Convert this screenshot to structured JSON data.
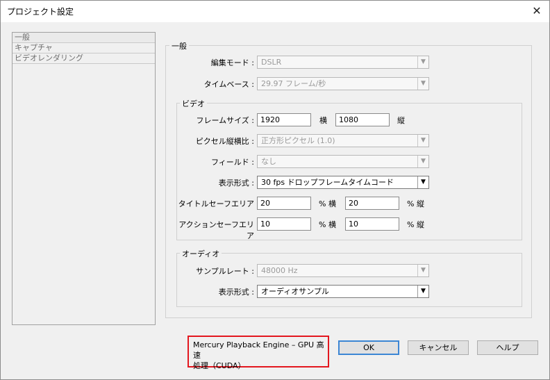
{
  "window": {
    "title": "プロジェクト設定",
    "close": "✕"
  },
  "sidebar": {
    "items": [
      {
        "label": "一般",
        "selected": true
      },
      {
        "label": "キャプチャ",
        "selected": false
      },
      {
        "label": "ビデオレンダリング",
        "selected": false
      }
    ]
  },
  "general": {
    "heading": "一般",
    "edit_mode": {
      "label": "編集モード :",
      "value": "DSLR"
    },
    "timebase": {
      "label": "タイムベース :",
      "value": "29.97 フレーム/秒"
    },
    "video": {
      "heading": "ビデオ",
      "frame_size": {
        "label": "フレームサイズ :",
        "width": "1920",
        "width_unit": "横",
        "height": "1080",
        "height_unit": "縦"
      },
      "pixel_aspect": {
        "label": "ピクセル縦横比 :",
        "value": "正方形ピクセル (1.0)"
      },
      "fields": {
        "label": "フィールド :",
        "value": "なし"
      },
      "display_format": {
        "label": "表示形式 :",
        "value": "30 fps ドロップフレームタイムコード"
      },
      "title_safe": {
        "label": "タイトルセーフエリア",
        "h": "20",
        "h_unit": "% 横",
        "v": "20",
        "v_unit": "% 縦"
      },
      "action_safe": {
        "label": "アクションセーフエリア",
        "h": "10",
        "h_unit": "% 横",
        "v": "10",
        "v_unit": "% 縦"
      }
    },
    "audio": {
      "heading": "オーディオ",
      "sample_rate": {
        "label": "サンプルレート :",
        "value": "48000 Hz"
      },
      "display_format": {
        "label": "表示形式 :",
        "value": "オーディオサンプル"
      }
    }
  },
  "playback": {
    "line1": "Mercury Playback Engine – GPU 高速",
    "line2": "処理（CUDA）"
  },
  "buttons": {
    "ok": "OK",
    "cancel": "キャンセル",
    "help": "ヘルプ"
  },
  "colors": {
    "highlight_border": "#e3161e",
    "default_button_border": "#3c86d4"
  },
  "icons": {
    "dropdown": "▼"
  }
}
